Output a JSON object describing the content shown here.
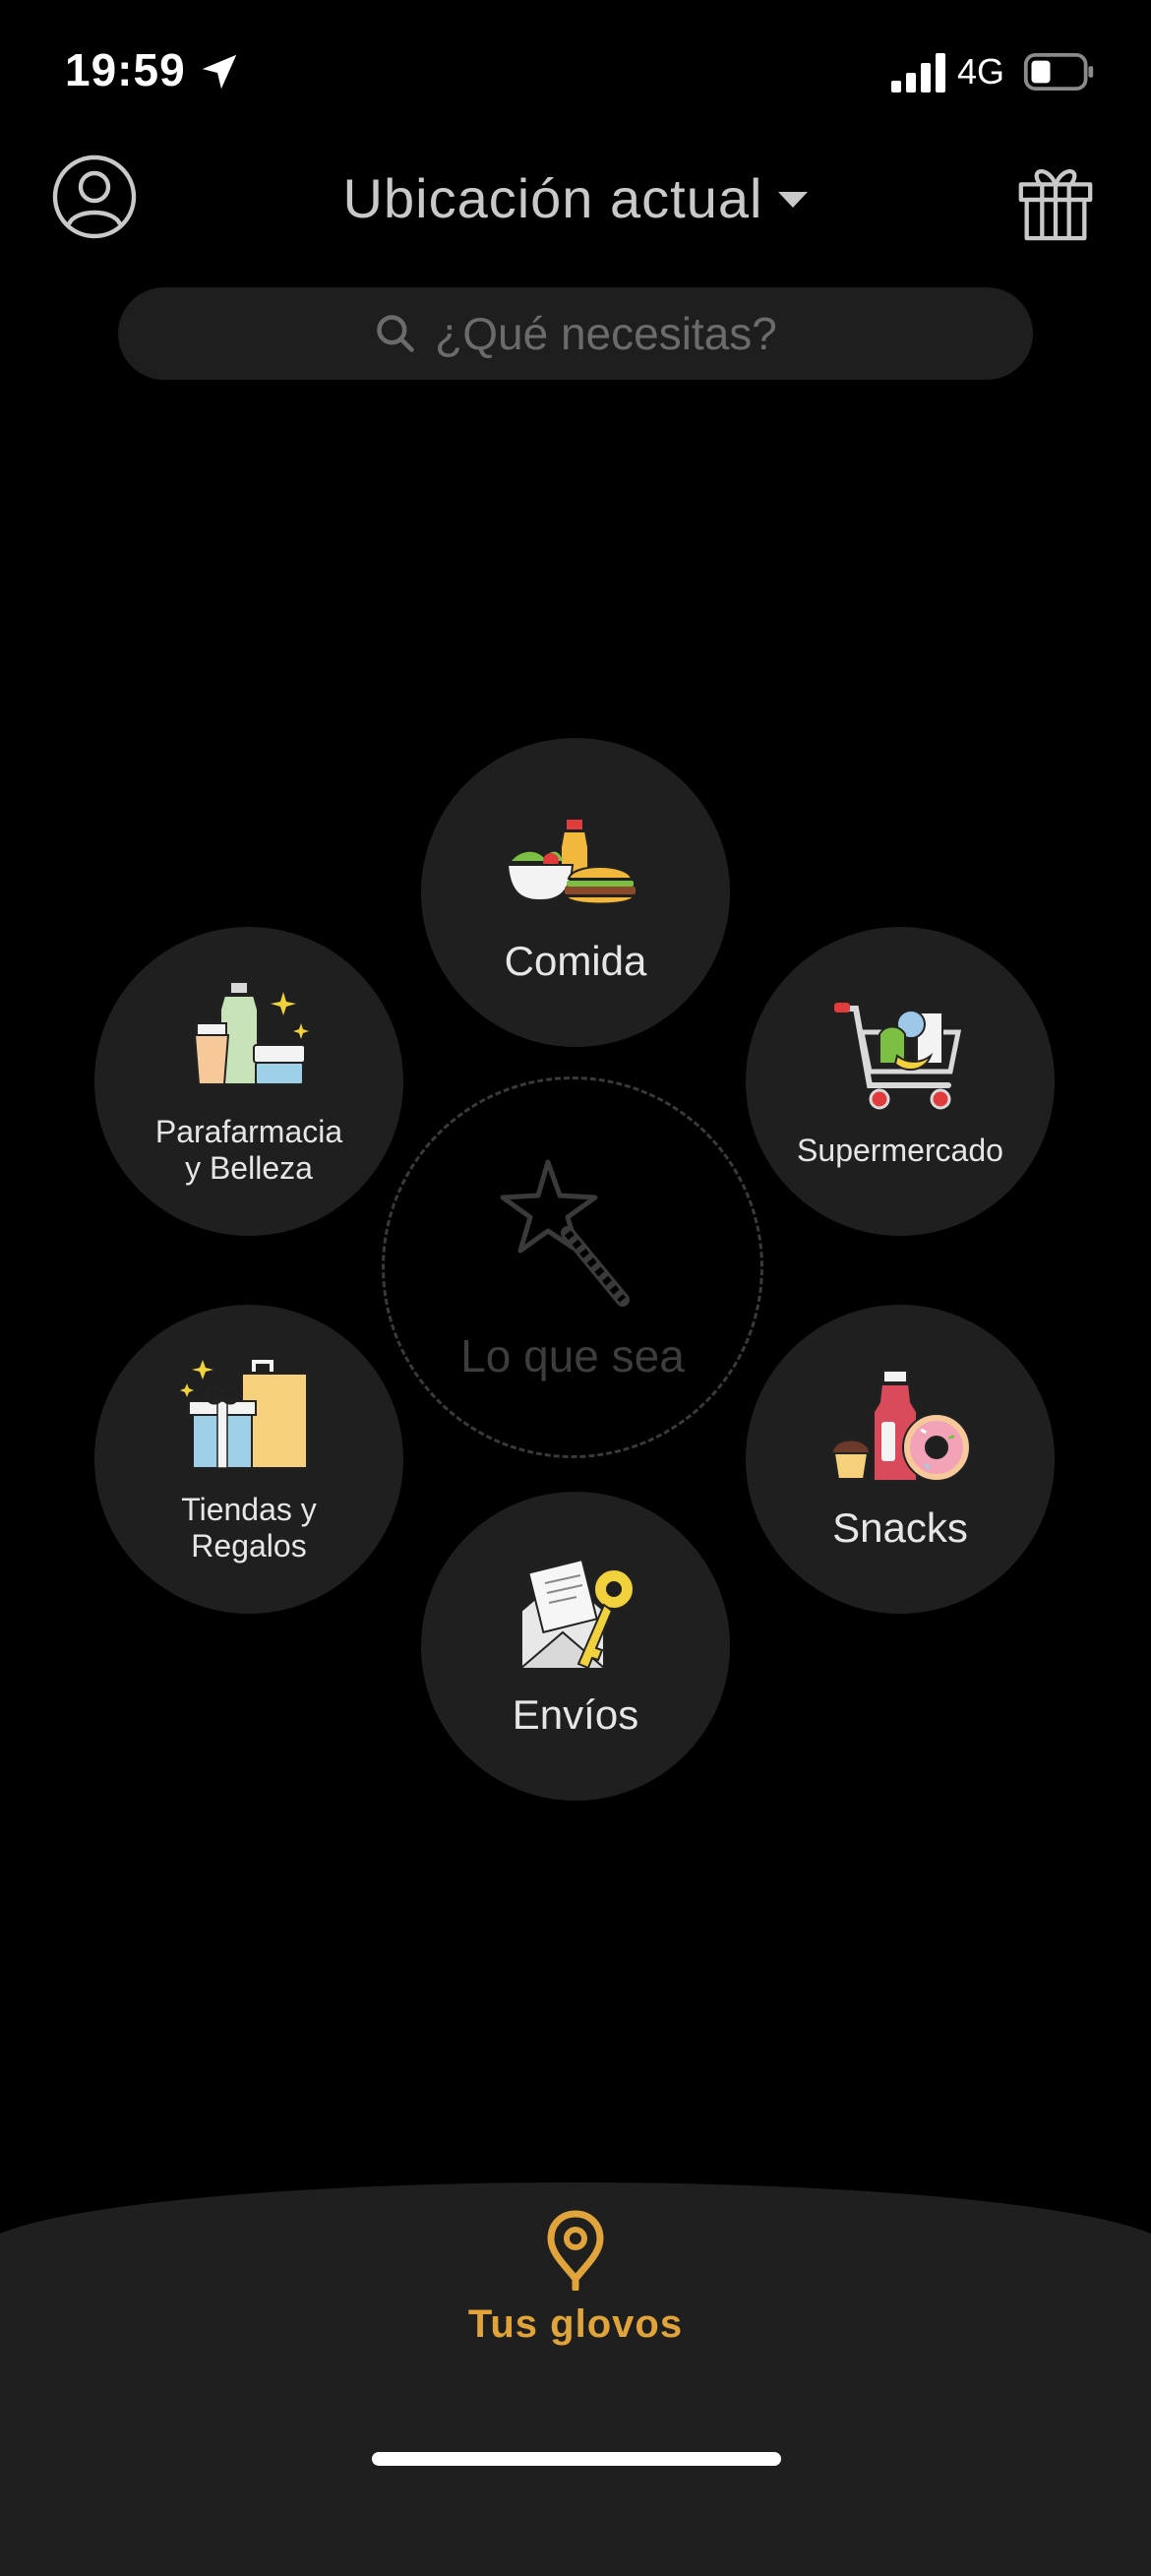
{
  "status_bar": {
    "time": "19:59",
    "network": "4G"
  },
  "header": {
    "location_label": "Ubicación actual"
  },
  "search": {
    "placeholder": "¿Qué necesitas?"
  },
  "categories": {
    "comida": "Comida",
    "supermercado": "Supermercado",
    "parafarmacia_line1": "Parafarmacia",
    "parafarmacia_line2": "y Belleza",
    "center": "Lo que sea",
    "tiendas_line1": "Tiendas y",
    "tiendas_line2": "Regalos",
    "snacks": "Snacks",
    "envios": "Envíos"
  },
  "bottom_nav": {
    "tab_label": "Tus glovos"
  },
  "colors": {
    "accent": "#e0a43b",
    "bubble": "#1f1f1f",
    "background": "#000000"
  }
}
